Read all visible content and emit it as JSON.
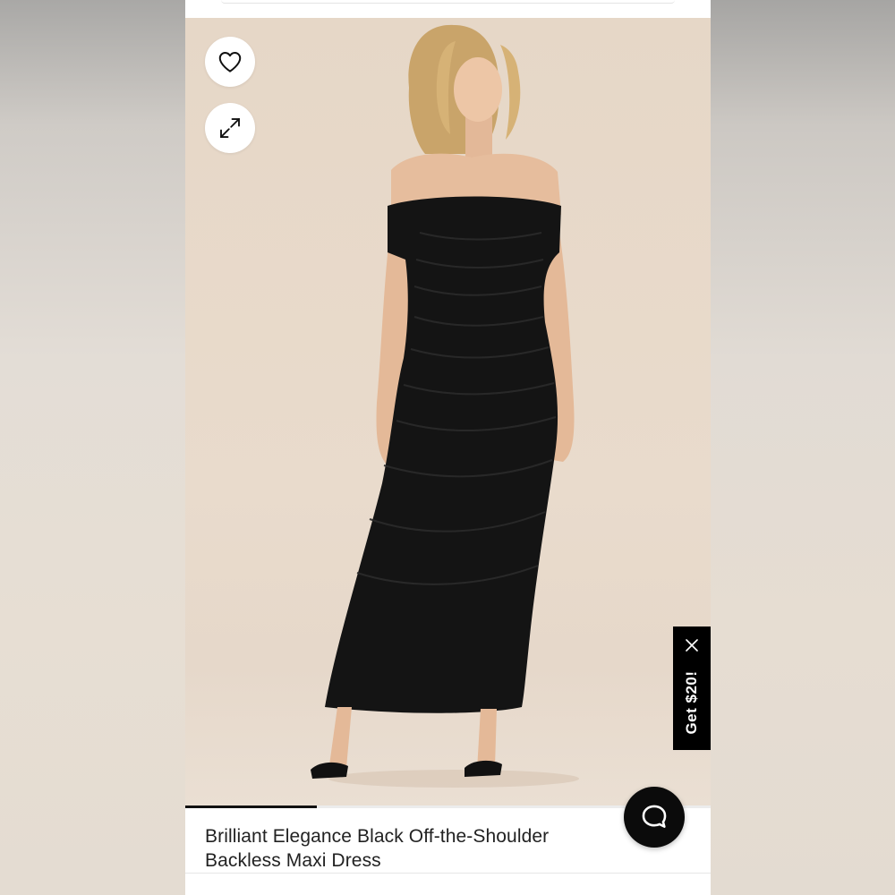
{
  "product": {
    "title": "Brilliant Elegance Black Off-the-Shoulder Backless Maxi Dress",
    "image_alt": "Model wearing black off-the-shoulder ruched maxi dress",
    "gallery_progress": 0.25
  },
  "actions": {
    "wishlist_icon": "heart-outline-icon",
    "expand_icon": "expand-arrows-icon"
  },
  "promo": {
    "label": "Get $20!",
    "close_icon": "close-icon"
  },
  "chat": {
    "icon": "chat-bubble-icon"
  },
  "colors": {
    "promo_bg": "#000000",
    "chat_bg": "#0b0b0b",
    "text": "#222222",
    "image_bg": "#e8d9c9"
  }
}
